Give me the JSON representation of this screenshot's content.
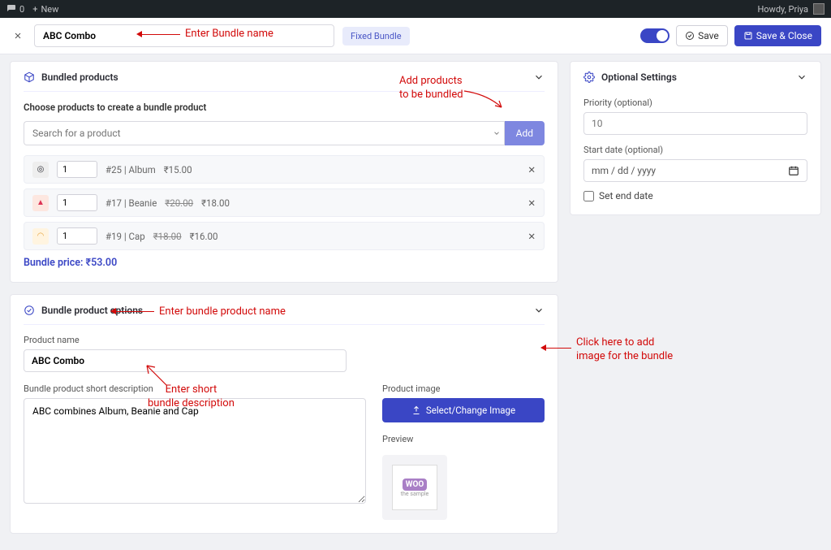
{
  "adminbar": {
    "comments_count": "0",
    "new_label": "New",
    "greeting": "Howdy, Priya"
  },
  "header": {
    "bundle_name": "ABC Combo",
    "fixed_badge": "Fixed Bundle",
    "save_label": "Save",
    "save_close_label": "Save & Close"
  },
  "bundled": {
    "title": "Bundled products",
    "choose_label": "Choose products to create a bundle product",
    "search_placeholder": "Search for a product",
    "add_label": "Add",
    "rows": [
      {
        "qty": "1",
        "id": "#25",
        "name": "Album",
        "price": "₹15.00",
        "original": ""
      },
      {
        "qty": "1",
        "id": "#17",
        "name": "Beanie",
        "price": "₹18.00",
        "original": "₹20.00"
      },
      {
        "qty": "1",
        "id": "#19",
        "name": "Cap",
        "price": "₹16.00",
        "original": "₹18.00"
      }
    ],
    "bundle_price_label": "Bundle price:",
    "bundle_price_value": "₹53.00"
  },
  "options": {
    "title": "Bundle product options",
    "product_name_label": "Product name",
    "product_name_value": "ABC Combo",
    "desc_label": "Bundle product short description",
    "desc_value": "ABC combines Album, Beanie and Cap",
    "image_label": "Product image",
    "image_button": "Select/Change Image",
    "preview_label": "Preview"
  },
  "optional": {
    "title": "Optional Settings",
    "priority_label": "Priority (optional)",
    "priority_placeholder": "10",
    "start_date_label": "Start date (optional)",
    "date_placeholder": "mm / dd / yyyy",
    "end_date_label": "Set end date"
  },
  "annotations": {
    "name": "Enter Bundle name",
    "add": "Add products to be bundled",
    "pname": "Enter bundle product name",
    "desc": "Enter short bundle description",
    "img": "Click here to add image for the bundle"
  }
}
